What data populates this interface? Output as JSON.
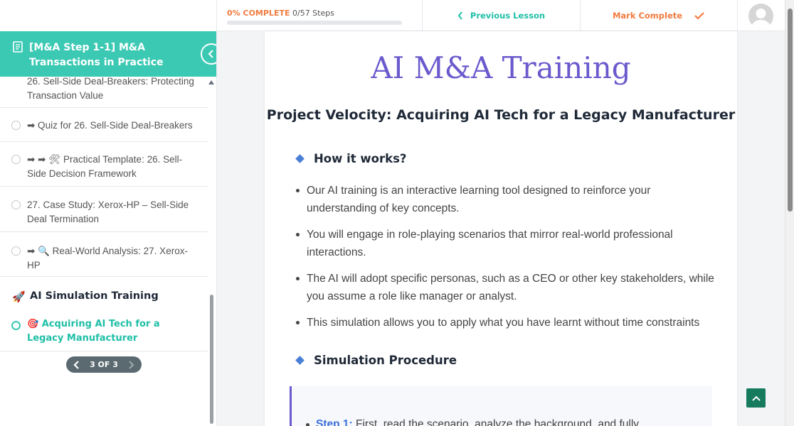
{
  "topbar": {
    "progress_percent_label": "0% COMPLETE",
    "progress_steps_label": "0/57 Steps",
    "progress_fraction": 0,
    "previous_lesson_label": "Previous Lesson",
    "mark_complete_label": "Mark Complete"
  },
  "sidebar": {
    "title": "[M&A Step 1-1] M&A Transactions in Practice",
    "items": [
      {
        "label": "26. Sell-Side Deal-Breakers: Protecting Transaction Value"
      },
      {
        "label": "➡ Quiz for 26. Sell-Side Deal-Breakers"
      },
      {
        "label": "➡ ➡ 🛠 Practical Template: 26. Sell-Side Decision Framework"
      },
      {
        "label": "27. Case Study: Xerox-HP – Sell-Side Deal Termination"
      },
      {
        "label": "➡ 🔍 Real-World Analysis: 27. Xerox-HP"
      }
    ],
    "section": {
      "icon": "🚀",
      "label": "AI Simulation Training"
    },
    "active_item": {
      "icon": "🎯",
      "label": "Acquiring AI Tech for a Legacy Manufacturer"
    },
    "pager": {
      "label": "3 OF 3"
    }
  },
  "main": {
    "title": "AI M&A Training",
    "subtitle": "Project Velocity: Acquiring AI Tech for a Legacy Manufacturer",
    "how_heading": "How it works?",
    "how_items": [
      "Our AI training is an interactive learning tool designed to reinforce your understanding of key concepts.",
      "You will engage in role-playing scenarios that mirror real-world professional interactions.",
      "The AI will adopt specific personas, such as a CEO or other key stakeholders, while you assume a role like manager or analyst.",
      "This simulation allows you to apply what you have learnt without time constraints"
    ],
    "procedure_heading": "Simulation Procedure",
    "step1_label": "Step 1:",
    "step1_text": " First, read the scenario, analyze the background, and fully"
  },
  "colors": {
    "teal": "#3cc9b4",
    "orange": "#f07b3f",
    "purple": "#6a5acd",
    "blue": "#4a7fd6",
    "dark_green": "#157b5c"
  },
  "icons": [
    "book-icon",
    "chevron-left-icon",
    "check-icon",
    "avatar-icon",
    "arrow-up-icon",
    "chevron-right-icon",
    "diamond-icon"
  ]
}
